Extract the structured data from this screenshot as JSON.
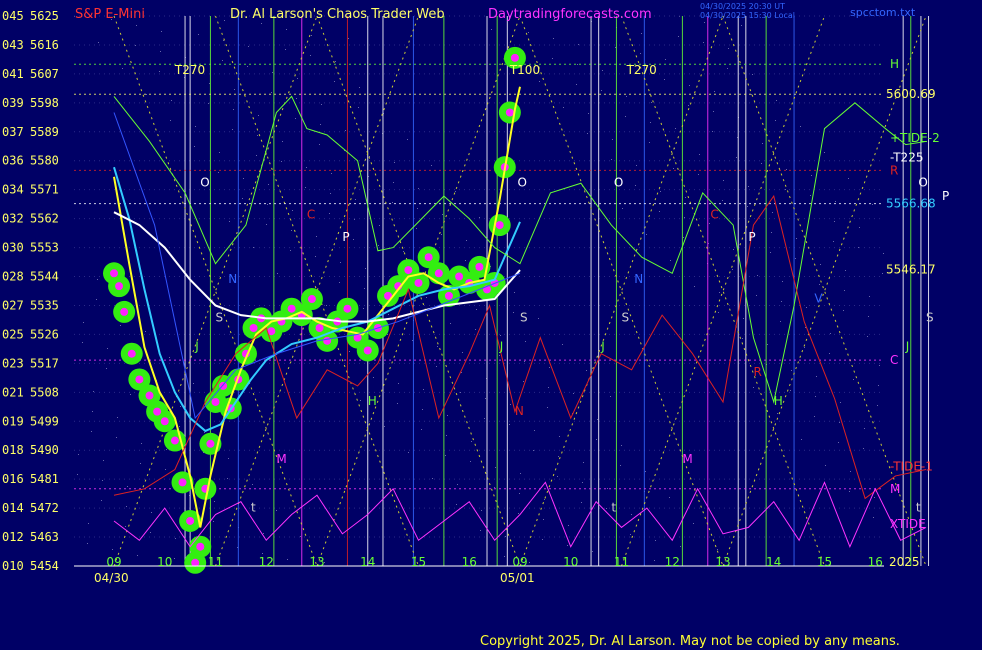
{
  "header": {
    "symbol": "S&P E-Mini",
    "site_title": "Dr. Al Larson's Chaos Trader Web",
    "site_url": "Daytradingforecasts.com",
    "stamp_ut": "04/30/2025 20:30 UT",
    "stamp_local": "04/30/2025 15:30 Local",
    "file": "spcctom.txt"
  },
  "footer": {
    "copyright": "Copyright 2025, Dr. Al Larson. May not be copied by any means."
  },
  "chart_data": {
    "type": "line",
    "title": "S&P E-Mini",
    "ylim": [
      5454,
      5625
    ],
    "y_ticks": [
      {
        "left": "045",
        "right": "5625"
      },
      {
        "left": "043",
        "right": "5616"
      },
      {
        "left": "041",
        "right": "5607"
      },
      {
        "left": "039",
        "right": "5598"
      },
      {
        "left": "037",
        "right": "5589"
      },
      {
        "left": "036",
        "right": "5580"
      },
      {
        "left": "034",
        "right": "5571"
      },
      {
        "left": "032",
        "right": "5562"
      },
      {
        "left": "030",
        "right": "5553"
      },
      {
        "left": "028",
        "right": "5544"
      },
      {
        "left": "027",
        "right": "5535"
      },
      {
        "left": "025",
        "right": "5526"
      },
      {
        "left": "023",
        "right": "5517"
      },
      {
        "left": "021",
        "right": "5508"
      },
      {
        "left": "019",
        "right": "5499"
      },
      {
        "left": "018",
        "right": "5490"
      },
      {
        "left": "016",
        "right": "5481"
      },
      {
        "left": "014",
        "right": "5472"
      },
      {
        "left": "012",
        "right": "5463"
      },
      {
        "left": "010",
        "right": "5454"
      }
    ],
    "x_ticks": [
      "09",
      "10",
      "11",
      "12",
      "13",
      "14",
      "15",
      "16",
      "09",
      "10",
      "11",
      "12",
      "13",
      "14",
      "15",
      "16"
    ],
    "date_labels": [
      "04/30",
      "05/01"
    ],
    "year": "2025",
    "price_labels": [
      {
        "text": "5600.69",
        "value": 5600.69
      },
      {
        "text": "5566.68",
        "value": 5566.68
      },
      {
        "text": "5546.17",
        "value": 5546.17
      }
    ],
    "right_labels": [
      {
        "text": "H",
        "color": "#66ff33",
        "value": 5610
      },
      {
        "text": "+TIDE-2",
        "color": "#66ff33",
        "value": 5587
      },
      {
        "text": "-T225",
        "color": "#ffffff",
        "value": 5581
      },
      {
        "text": "R",
        "color": "#dd2222",
        "value": 5577
      },
      {
        "text": "P",
        "color": "#ffffff",
        "value": 5569
      },
      {
        "text": "C",
        "color": "#ff33ff",
        "value": 5518
      },
      {
        "text": "-TIDE-1",
        "color": "#ff3333",
        "value": 5485
      },
      {
        "text": "M",
        "color": "#ff33ff",
        "value": 5478
      },
      {
        "text": "XTIDE",
        "color": "#ff33ff",
        "value": 5467
      }
    ],
    "annotations": [
      {
        "text": "T270",
        "t": 1.2,
        "value": 5607,
        "color": "#ffff66"
      },
      {
        "text": "T100",
        "t": 7.8,
        "value": 5607,
        "color": "#ffff66"
      },
      {
        "text": "T270",
        "t": 10.1,
        "value": 5607,
        "color": "#ffff66"
      },
      {
        "text": "O",
        "t": 1.7,
        "value": 5572,
        "color": "#ffffff"
      },
      {
        "text": "O",
        "t": 7.95,
        "value": 5572,
        "color": "#ffffff"
      },
      {
        "text": "O",
        "t": 9.85,
        "value": 5572,
        "color": "#ffffff"
      },
      {
        "text": "O",
        "t": 15.85,
        "value": 5572,
        "color": "#ffffff"
      },
      {
        "text": "C",
        "t": 3.8,
        "value": 5562,
        "color": "#dd2222"
      },
      {
        "text": "C",
        "t": 11.75,
        "value": 5562,
        "color": "#dd2222"
      },
      {
        "text": "P",
        "t": 4.5,
        "value": 5555,
        "color": "#ffffff"
      },
      {
        "text": "P",
        "t": 12.5,
        "value": 5555,
        "color": "#ffffff"
      },
      {
        "text": "N",
        "t": 2.25,
        "value": 5542,
        "color": "#3366ff"
      },
      {
        "text": "N",
        "t": 10.25,
        "value": 5542,
        "color": "#3366ff"
      },
      {
        "text": "S",
        "t": 2.0,
        "value": 5530,
        "color": "#cccccc"
      },
      {
        "text": "S",
        "t": 8.0,
        "value": 5530,
        "color": "#cccccc"
      },
      {
        "text": "S",
        "t": 10.0,
        "value": 5530,
        "color": "#cccccc"
      },
      {
        "text": "S",
        "t": 16.0,
        "value": 5530,
        "color": "#cccccc"
      },
      {
        "text": "J",
        "t": 1.6,
        "value": 5521,
        "color": "#66ff33"
      },
      {
        "text": "J",
        "t": 7.6,
        "value": 5521,
        "color": "#66ff33"
      },
      {
        "text": "J",
        "t": 9.6,
        "value": 5521,
        "color": "#66ff33"
      },
      {
        "text": "J",
        "t": 15.6,
        "value": 5521,
        "color": "#66ff33"
      },
      {
        "text": "V",
        "t": 13.8,
        "value": 5536,
        "color": "#3366ff"
      },
      {
        "text": "R",
        "t": 12.6,
        "value": 5513,
        "color": "#dd2222"
      },
      {
        "text": "H",
        "t": 5.0,
        "value": 5504,
        "color": "#66ff33"
      },
      {
        "text": "H",
        "t": 13.0,
        "value": 5504,
        "color": "#66ff33"
      },
      {
        "text": "M",
        "t": 3.2,
        "value": 5486,
        "color": "#ff33ff"
      },
      {
        "text": "M",
        "t": 11.2,
        "value": 5486,
        "color": "#ff33ff"
      },
      {
        "text": "N",
        "t": 7.9,
        "value": 5501,
        "color": "#dd2222"
      },
      {
        "text": "t",
        "t": 2.7,
        "value": 5471,
        "color": "#cccccc"
      },
      {
        "text": "t",
        "t": 9.8,
        "value": 5471,
        "color": "#cccccc"
      },
      {
        "text": "t",
        "t": 15.8,
        "value": 5471,
        "color": "#cccccc"
      }
    ],
    "series": [
      {
        "color": "#33ee11",
        "role": "glow",
        "x": [
          0,
          0.1,
          0.2,
          0.35,
          0.5,
          0.7,
          0.85,
          1.0,
          1.2,
          1.35,
          1.5,
          1.6,
          1.7,
          1.8,
          1.9,
          2.0,
          2.15,
          2.3,
          2.45,
          2.6,
          2.75,
          2.9,
          3.1,
          3.3,
          3.5,
          3.7,
          3.9,
          4.05,
          4.2,
          4.4,
          4.6,
          4.8,
          5.0,
          5.2,
          5.4,
          5.6,
          5.8,
          6.0,
          6.2,
          6.4,
          6.6,
          6.8,
          7.0,
          7.2,
          7.35,
          7.5,
          7.6,
          7.7,
          7.8,
          7.9
        ],
        "values": [
          5545,
          5541,
          5533,
          5520,
          5512,
          5507,
          5502,
          5499,
          5493,
          5480,
          5468,
          5455,
          5460,
          5478,
          5492,
          5505,
          5510,
          5503,
          5512,
          5520,
          5528,
          5531,
          5527,
          5530,
          5534,
          5532,
          5537,
          5528,
          5524,
          5530,
          5534,
          5525,
          5521,
          5528,
          5538,
          5541,
          5546,
          5542,
          5550,
          5545,
          5538,
          5544,
          5542,
          5547,
          5540,
          5542,
          5560,
          5578,
          5595,
          5612
        ]
      },
      {
        "color": "#ff22ff",
        "role": "dots",
        "x": [
          0,
          0.1,
          0.2,
          0.35,
          0.5,
          0.7,
          0.85,
          1.0,
          1.2,
          1.35,
          1.5,
          1.6,
          1.7,
          1.8,
          1.9,
          2.0,
          2.15,
          2.3,
          2.45,
          2.6,
          2.75,
          2.9,
          3.1,
          3.3,
          3.5,
          3.7,
          3.9,
          4.05,
          4.2,
          4.4,
          4.6,
          4.8,
          5.0,
          5.2,
          5.4,
          5.6,
          5.8,
          6.0,
          6.2,
          6.4,
          6.6,
          6.8,
          7.0,
          7.2,
          7.35,
          7.5,
          7.6,
          7.7,
          7.8,
          7.9
        ],
        "values": [
          5545,
          5541,
          5533,
          5520,
          5512,
          5507,
          5502,
          5499,
          5493,
          5480,
          5468,
          5455,
          5460,
          5478,
          5492,
          5505,
          5510,
          5503,
          5512,
          5520,
          5528,
          5531,
          5527,
          5530,
          5534,
          5532,
          5537,
          5528,
          5524,
          5530,
          5534,
          5525,
          5521,
          5528,
          5538,
          5541,
          5546,
          5542,
          5550,
          5545,
          5538,
          5544,
          5542,
          5547,
          5540,
          5542,
          5560,
          5578,
          5595,
          5612
        ]
      },
      {
        "color": "#ffff22",
        "x": [
          0,
          0.3,
          0.6,
          0.9,
          1.2,
          1.5,
          1.7,
          1.9,
          2.2,
          2.5,
          2.8,
          3.1,
          3.4,
          3.7,
          4.0,
          4.3,
          4.6,
          4.9,
          5.2,
          5.5,
          5.8,
          6.1,
          6.4,
          6.7,
          7.0,
          7.3,
          7.6,
          7.9,
          8.0
        ],
        "values": [
          5575,
          5548,
          5522,
          5508,
          5500,
          5482,
          5466,
          5482,
          5502,
          5515,
          5526,
          5530,
          5531,
          5533,
          5530,
          5528,
          5527,
          5526,
          5532,
          5538,
          5544,
          5545,
          5542,
          5540,
          5542,
          5543,
          5568,
          5596,
          5603
        ]
      },
      {
        "color": "#33ccff",
        "x": [
          0,
          0.3,
          0.6,
          0.9,
          1.2,
          1.5,
          1.8,
          2.1,
          2.4,
          2.7,
          3.0,
          3.5,
          4.0,
          4.5,
          5.0,
          5.5,
          6.0,
          6.5,
          7.0,
          7.5,
          8.0
        ],
        "values": [
          5578,
          5562,
          5540,
          5520,
          5508,
          5500,
          5496,
          5498,
          5505,
          5512,
          5518,
          5523,
          5525,
          5528,
          5530,
          5534,
          5538,
          5540,
          5541,
          5543,
          5561
        ]
      },
      {
        "color": "#ffffff",
        "x": [
          0,
          0.5,
          1.0,
          1.5,
          2.0,
          2.5,
          3.0,
          3.5,
          4.0,
          4.5,
          5.0,
          5.5,
          6.0,
          6.5,
          7.0,
          7.5,
          8.0
        ],
        "values": [
          5564,
          5560,
          5553,
          5543,
          5535,
          5532,
          5531,
          5531,
          5531,
          5530,
          5530,
          5531,
          5533,
          5535,
          5536,
          5537,
          5546
        ]
      },
      {
        "color": "#66ff33",
        "x": [
          0,
          0.7,
          1.4,
          2.0,
          2.6,
          3.2,
          3.5,
          3.8,
          4.2,
          4.8,
          5.2,
          5.5,
          6.0,
          6.5,
          7.0,
          7.5,
          8.0,
          8.6,
          9.2,
          9.8,
          10.4,
          11.0,
          11.6,
          12.2,
          12.6,
          13.0,
          13.4,
          14.0,
          14.6,
          15.2,
          15.6,
          16.0
        ],
        "values": [
          5600,
          5586,
          5570,
          5548,
          5560,
          5595,
          5600,
          5590,
          5588,
          5580,
          5552,
          5553,
          5561,
          5569,
          5562,
          5553,
          5548,
          5570,
          5573,
          5560,
          5550,
          5545,
          5570,
          5560,
          5525,
          5505,
          5535,
          5590,
          5598,
          5590,
          5585,
          5586
        ]
      },
      {
        "color": "#dd2222",
        "x": [
          0,
          0.6,
          1.2,
          1.8,
          2.4,
          3.0,
          3.6,
          4.2,
          4.8,
          5.2,
          5.8,
          6.4,
          7.0,
          7.4,
          7.9,
          8.4,
          9.0,
          9.6,
          10.2,
          10.8,
          11.4,
          12.0,
          12.6,
          13.0,
          13.6,
          14.2,
          14.8,
          15.4,
          16.0
        ],
        "values": [
          5476,
          5478,
          5484,
          5505,
          5520,
          5528,
          5500,
          5515,
          5510,
          5517,
          5540,
          5500,
          5520,
          5535,
          5502,
          5525,
          5500,
          5520,
          5515,
          5532,
          5520,
          5505,
          5560,
          5569,
          5530,
          5506,
          5475,
          5482,
          5484
        ]
      },
      {
        "color": "#3355ff",
        "x": [
          0,
          0.8,
          1.6,
          2.4,
          3.2,
          4.0,
          4.8,
          5.6,
          6.4,
          7.2,
          8.0
        ],
        "values": [
          5595,
          5560,
          5500,
          5515,
          5520,
          5524,
          5526,
          5530,
          5535,
          5540,
          5545
        ]
      },
      {
        "color": "#ff33ff",
        "x": [
          0,
          0.5,
          1.0,
          1.5,
          2.0,
          2.5,
          3.0,
          3.5,
          4.0,
          4.5,
          5.0,
          5.5,
          6.0,
          6.5,
          7.0,
          7.5,
          8.0,
          8.5,
          9.0,
          9.5,
          10.0,
          10.5,
          11.0,
          11.5,
          12.0,
          12.5,
          13.0,
          13.5,
          14.0,
          14.5,
          15.0,
          15.5,
          16.0
        ],
        "values": [
          5468,
          5462,
          5472,
          5460,
          5470,
          5474,
          5462,
          5470,
          5476,
          5464,
          5470,
          5478,
          5462,
          5468,
          5474,
          5462,
          5470,
          5480,
          5460,
          5474,
          5466,
          5472,
          5462,
          5478,
          5464,
          5466,
          5474,
          5462,
          5480,
          5460,
          5478,
          5462,
          5466
        ]
      }
    ]
  }
}
